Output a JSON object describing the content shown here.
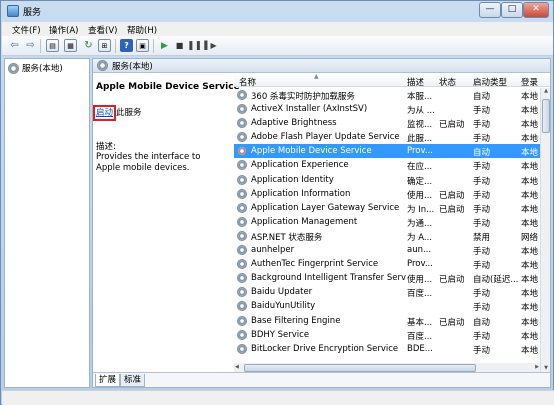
{
  "window": {
    "title": "服务",
    "minimize": "—",
    "maximize": "□",
    "close": "✕"
  },
  "menu": [
    "文件(F)",
    "操作(A)",
    "查看(V)",
    "帮助(H)"
  ],
  "toolbar": {
    "back_icon": "back-arrow-icon",
    "forward_icon": "forward-arrow-icon"
  },
  "tree": {
    "root_label": "服务(本地)"
  },
  "panel": {
    "header": "服务(本地)"
  },
  "detail": {
    "service_name": "Apple Mobile Device Service",
    "start_link": "启动",
    "start_suffix": "此服务",
    "desc_label": "描述:",
    "desc_text": "Provides the interface to Apple mobile devices."
  },
  "columns": [
    "名称",
    "描述",
    "状态",
    "启动类型",
    "登录"
  ],
  "services": [
    [
      "360 杀毒实时防护加载服务",
      "本服...",
      "",
      "自动",
      "本地"
    ],
    [
      "ActiveX Installer (AxInstSV)",
      "为从 ...",
      "",
      "手动",
      "本地"
    ],
    [
      "Adaptive Brightness",
      "监视...",
      "已启动",
      "手动",
      "本地"
    ],
    [
      "Adobe Flash Player Update Service",
      "此服...",
      "",
      "手动",
      "本地"
    ],
    [
      "Apple Mobile Device Service",
      "Prov...",
      "",
      "自动",
      "本地"
    ],
    [
      "Application Experience",
      "在应...",
      "",
      "手动",
      "本地"
    ],
    [
      "Application Identity",
      "确定...",
      "",
      "手动",
      "本地"
    ],
    [
      "Application Information",
      "使用...",
      "已启动",
      "手动",
      "本地"
    ],
    [
      "Application Layer Gateway Service",
      "为 In...",
      "已启动",
      "手动",
      "本地"
    ],
    [
      "Application Management",
      "为通...",
      "",
      "手动",
      "本地"
    ],
    [
      "ASP.NET 状态服务",
      "为 A...",
      "",
      "禁用",
      "网络"
    ],
    [
      "aunhelper",
      "aun...",
      "",
      "手动",
      "本地"
    ],
    [
      "AuthenTec Fingerprint Service",
      "Prov...",
      "",
      "手动",
      "本地"
    ],
    [
      "Background Intelligent Transfer Serv...",
      "使用...",
      "已启动",
      "自动(延迟...",
      "本地"
    ],
    [
      "Baidu Updater",
      "百度...",
      "",
      "手动",
      "本地"
    ],
    [
      "BaiduYunUtility",
      "",
      "",
      "手动",
      "本地"
    ],
    [
      "Base Filtering Engine",
      "基本...",
      "已启动",
      "自动",
      "本地"
    ],
    [
      "BDHY Service",
      "百度...",
      "",
      "手动",
      "本地"
    ],
    [
      "BitLocker Drive Encryption Service",
      "BDE...",
      "",
      "手动",
      "本地"
    ]
  ],
  "selected_index": 4,
  "tabs": [
    "扩展",
    "标准"
  ],
  "colors": {
    "selection": "#3399ff",
    "highlight_box": "#e81c1c",
    "link": "#0b4fb0"
  }
}
